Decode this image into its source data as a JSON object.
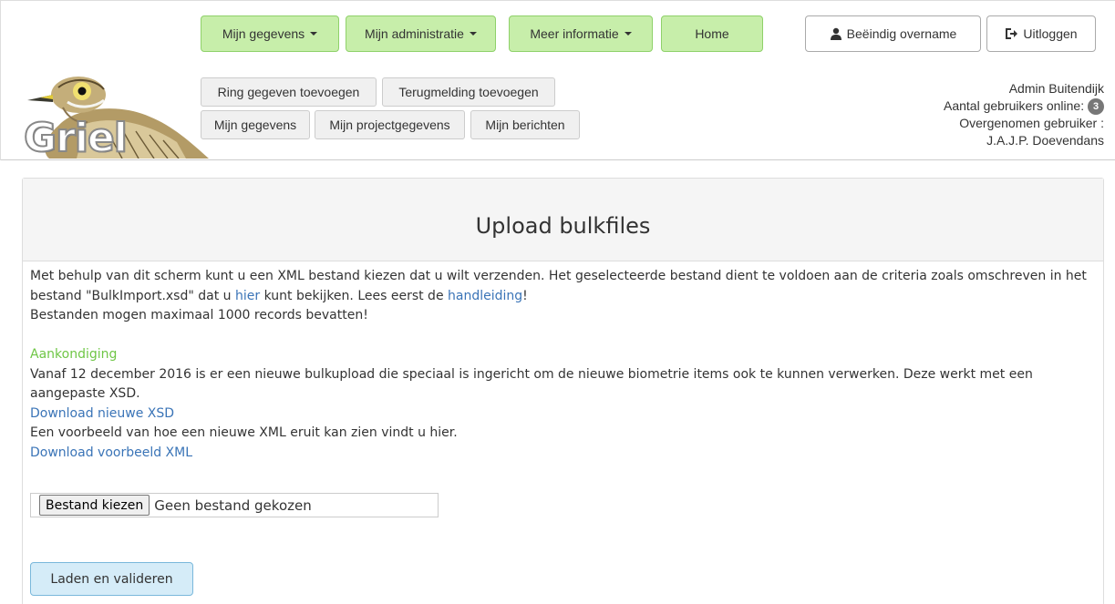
{
  "nav": {
    "mijn_gegevens": "Mijn gegevens",
    "mijn_administratie": "Mijn administratie",
    "meer_informatie": "Meer informatie",
    "home": "Home"
  },
  "header_actions": {
    "beeindig_overname": "Beëindig overname",
    "uitloggen": "Uitloggen"
  },
  "quick_links": {
    "ring_toevoegen": "Ring gegeven toevoegen",
    "terugmelding_toevoegen": "Terugmelding toevoegen",
    "mijn_gegevens": "Mijn gegevens",
    "mijn_projectgegevens": "Mijn projectgegevens",
    "mijn_berichten": "Mijn berichten"
  },
  "logo": {
    "text": "Griel"
  },
  "user": {
    "name": "Admin Buitendijk",
    "online_label": "Aantal gebruikers online:",
    "online_count": "3",
    "overgenomen_label": "Overgenomen gebruiker :",
    "overgenomen_name": "J.A.J.P. Doevendans"
  },
  "panel": {
    "title": "Upload bulkfiles",
    "intro_part1": "Met behulp van dit scherm kunt u een XML bestand kiezen dat u wilt verzenden. Het geselecteerde bestand dient te voldoen aan de criteria zoals omschreven in het bestand \"BulkImport.xsd\" dat u ",
    "intro_link_hier": "hier",
    "intro_part2": " kunt bekijken. Lees eerst de ",
    "intro_link_handleiding": "handleiding",
    "intro_part3": "!",
    "max_records": "Bestanden mogen maximaal 1000 records bevatten!",
    "announcement_title": "Aankondiging",
    "announcement_text": "Vanaf 12 december 2016 is er een nieuwe bulkupload die speciaal is ingericht om de nieuwe biometrie items ook te kunnen verwerken. Deze werkt met een aangepaste XSD.",
    "download_xsd": "Download nieuwe XSD",
    "example_text": "Een voorbeeld van hoe een nieuwe XML eruit kan zien vindt u hier.",
    "download_xml": "Download voorbeeld XML"
  },
  "file_input": {
    "button_label": "Bestand kiezen",
    "status": "Geen bestand gekozen"
  },
  "submit": {
    "label": "Laden en valideren"
  }
}
